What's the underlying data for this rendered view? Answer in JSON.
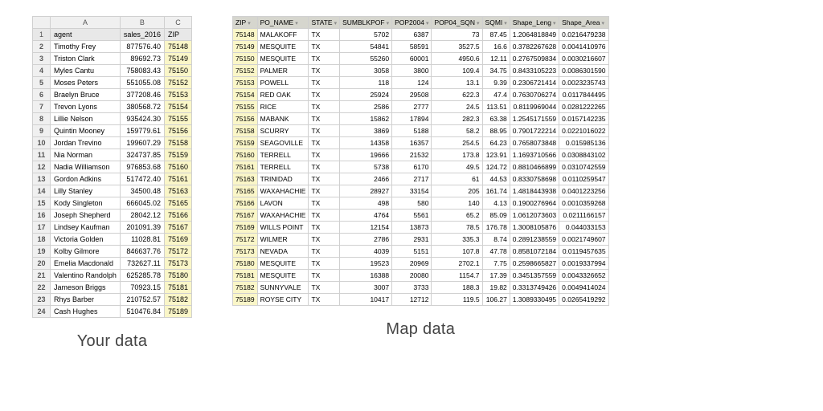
{
  "left": {
    "caption": "Your data",
    "col_letters": [
      "A",
      "B",
      "C"
    ],
    "headers": [
      "agent",
      "sales_2016",
      "ZIP"
    ],
    "rows": [
      {
        "n": 2,
        "agent": "Timothy Frey",
        "sales": "877576.40",
        "zip": "75148"
      },
      {
        "n": 3,
        "agent": "Triston Clark",
        "sales": "89692.73",
        "zip": "75149"
      },
      {
        "n": 4,
        "agent": "Myles Cantu",
        "sales": "758083.43",
        "zip": "75150"
      },
      {
        "n": 5,
        "agent": "Moses Peters",
        "sales": "551055.08",
        "zip": "75152"
      },
      {
        "n": 6,
        "agent": "Braelyn Bruce",
        "sales": "377208.46",
        "zip": "75153"
      },
      {
        "n": 7,
        "agent": "Trevon Lyons",
        "sales": "380568.72",
        "zip": "75154"
      },
      {
        "n": 8,
        "agent": "Lillie Nelson",
        "sales": "935424.30",
        "zip": "75155"
      },
      {
        "n": 9,
        "agent": "Quintin Mooney",
        "sales": "159779.61",
        "zip": "75156"
      },
      {
        "n": 10,
        "agent": "Jordan Trevino",
        "sales": "199607.29",
        "zip": "75158"
      },
      {
        "n": 11,
        "agent": "Nia Norman",
        "sales": "324737.85",
        "zip": "75159"
      },
      {
        "n": 12,
        "agent": "Nadia Williamson",
        "sales": "976853.68",
        "zip": "75160"
      },
      {
        "n": 13,
        "agent": "Gordon Adkins",
        "sales": "517472.40",
        "zip": "75161"
      },
      {
        "n": 14,
        "agent": "Lilly Stanley",
        "sales": "34500.48",
        "zip": "75163"
      },
      {
        "n": 15,
        "agent": "Kody Singleton",
        "sales": "666045.02",
        "zip": "75165"
      },
      {
        "n": 16,
        "agent": "Joseph Shepherd",
        "sales": "28042.12",
        "zip": "75166"
      },
      {
        "n": 17,
        "agent": "Lindsey Kaufman",
        "sales": "201091.39",
        "zip": "75167"
      },
      {
        "n": 18,
        "agent": "Victoria Golden",
        "sales": "11028.81",
        "zip": "75169"
      },
      {
        "n": 19,
        "agent": "Kolby Gilmore",
        "sales": "846637.76",
        "zip": "75172"
      },
      {
        "n": 20,
        "agent": "Emelia Macdonald",
        "sales": "732627.11",
        "zip": "75173"
      },
      {
        "n": 21,
        "agent": "Valentino Randolph",
        "sales": "625285.78",
        "zip": "75180"
      },
      {
        "n": 22,
        "agent": "Jameson Briggs",
        "sales": "70923.15",
        "zip": "75181"
      },
      {
        "n": 23,
        "agent": "Rhys Barber",
        "sales": "210752.57",
        "zip": "75182"
      },
      {
        "n": 24,
        "agent": "Cash Hughes",
        "sales": "510476.84",
        "zip": "75189"
      }
    ]
  },
  "right": {
    "caption": "Map data",
    "headers": [
      "ZIP",
      "PO_NAME",
      "STATE",
      "SUMBLKPOF",
      "POP2004",
      "POP04_SQN",
      "SQMI",
      "Shape_Leng",
      "Shape_Area"
    ],
    "filter_glyph": "▾",
    "rows": [
      {
        "zip": "75148",
        "po": "MALAKOFF",
        "st": "TX",
        "sb": "5702",
        "p04": "6387",
        "psq": "73",
        "sqmi": "87.45",
        "len": "1.2064818849",
        "area": "0.0216479238"
      },
      {
        "zip": "75149",
        "po": "MESQUITE",
        "st": "TX",
        "sb": "54841",
        "p04": "58591",
        "psq": "3527.5",
        "sqmi": "16.6",
        "len": "0.3782267628",
        "area": "0.0041410976"
      },
      {
        "zip": "75150",
        "po": "MESQUITE",
        "st": "TX",
        "sb": "55260",
        "p04": "60001",
        "psq": "4950.6",
        "sqmi": "12.11",
        "len": "0.2767509834",
        "area": "0.0030216607"
      },
      {
        "zip": "75152",
        "po": "PALMER",
        "st": "TX",
        "sb": "3058",
        "p04": "3800",
        "psq": "109.4",
        "sqmi": "34.75",
        "len": "0.8433105223",
        "area": "0.0086301590"
      },
      {
        "zip": "75153",
        "po": "POWELL",
        "st": "TX",
        "sb": "118",
        "p04": "124",
        "psq": "13.1",
        "sqmi": "9.39",
        "len": "0.2306721414",
        "area": "0.0023235743"
      },
      {
        "zip": "75154",
        "po": "RED OAK",
        "st": "TX",
        "sb": "25924",
        "p04": "29508",
        "psq": "622.3",
        "sqmi": "47.4",
        "len": "0.7630706274",
        "area": "0.0117844495"
      },
      {
        "zip": "75155",
        "po": "RICE",
        "st": "TX",
        "sb": "2586",
        "p04": "2777",
        "psq": "24.5",
        "sqmi": "113.51",
        "len": "0.8119969044",
        "area": "0.0281222265"
      },
      {
        "zip": "75156",
        "po": "MABANK",
        "st": "TX",
        "sb": "15862",
        "p04": "17894",
        "psq": "282.3",
        "sqmi": "63.38",
        "len": "1.2545171559",
        "area": "0.0157142235"
      },
      {
        "zip": "75158",
        "po": "SCURRY",
        "st": "TX",
        "sb": "3869",
        "p04": "5188",
        "psq": "58.2",
        "sqmi": "88.95",
        "len": "0.7901722214",
        "area": "0.0221016022"
      },
      {
        "zip": "75159",
        "po": "SEAGOVILLE",
        "st": "TX",
        "sb": "14358",
        "p04": "16357",
        "psq": "254.5",
        "sqmi": "64.23",
        "len": "0.7658073848",
        "area": "0.015985136"
      },
      {
        "zip": "75160",
        "po": "TERRELL",
        "st": "TX",
        "sb": "19666",
        "p04": "21532",
        "psq": "173.8",
        "sqmi": "123.91",
        "len": "1.1693710566",
        "area": "0.0308843102"
      },
      {
        "zip": "75161",
        "po": "TERRELL",
        "st": "TX",
        "sb": "5738",
        "p04": "6170",
        "psq": "49.5",
        "sqmi": "124.72",
        "len": "0.8810466899",
        "area": "0.0310742559"
      },
      {
        "zip": "75163",
        "po": "TRINIDAD",
        "st": "TX",
        "sb": "2466",
        "p04": "2717",
        "psq": "61",
        "sqmi": "44.53",
        "len": "0.8330758698",
        "area": "0.0110259547"
      },
      {
        "zip": "75165",
        "po": "WAXAHACHIE",
        "st": "TX",
        "sb": "28927",
        "p04": "33154",
        "psq": "205",
        "sqmi": "161.74",
        "len": "1.4818443938",
        "area": "0.0401223256"
      },
      {
        "zip": "75166",
        "po": "LAVON",
        "st": "TX",
        "sb": "498",
        "p04": "580",
        "psq": "140",
        "sqmi": "4.13",
        "len": "0.1900276964",
        "area": "0.0010359268"
      },
      {
        "zip": "75167",
        "po": "WAXAHACHIE",
        "st": "TX",
        "sb": "4764",
        "p04": "5561",
        "psq": "65.2",
        "sqmi": "85.09",
        "len": "1.0612073603",
        "area": "0.0211166157"
      },
      {
        "zip": "75169",
        "po": "WILLS POINT",
        "st": "TX",
        "sb": "12154",
        "p04": "13873",
        "psq": "78.5",
        "sqmi": "176.78",
        "len": "1.3008105876",
        "area": "0.044033153"
      },
      {
        "zip": "75172",
        "po": "WILMER",
        "st": "TX",
        "sb": "2786",
        "p04": "2931",
        "psq": "335.3",
        "sqmi": "8.74",
        "len": "0.2891238559",
        "area": "0.0021749607"
      },
      {
        "zip": "75173",
        "po": "NEVADA",
        "st": "TX",
        "sb": "4039",
        "p04": "5151",
        "psq": "107.8",
        "sqmi": "47.78",
        "len": "0.8581072184",
        "area": "0.0119457635"
      },
      {
        "zip": "75180",
        "po": "MESQUITE",
        "st": "TX",
        "sb": "19523",
        "p04": "20969",
        "psq": "2702.1",
        "sqmi": "7.75",
        "len": "0.2598665827",
        "area": "0.0019337994"
      },
      {
        "zip": "75181",
        "po": "MESQUITE",
        "st": "TX",
        "sb": "16388",
        "p04": "20080",
        "psq": "1154.7",
        "sqmi": "17.39",
        "len": "0.3451357559",
        "area": "0.0043326652"
      },
      {
        "zip": "75182",
        "po": "SUNNYVALE",
        "st": "TX",
        "sb": "3007",
        "p04": "3733",
        "psq": "188.3",
        "sqmi": "19.82",
        "len": "0.3313749426",
        "area": "0.0049414024"
      },
      {
        "zip": "75189",
        "po": "ROYSE CITY",
        "st": "TX",
        "sb": "10417",
        "p04": "12712",
        "psq": "119.5",
        "sqmi": "106.27",
        "len": "1.3089330495",
        "area": "0.0265419292"
      }
    ]
  }
}
